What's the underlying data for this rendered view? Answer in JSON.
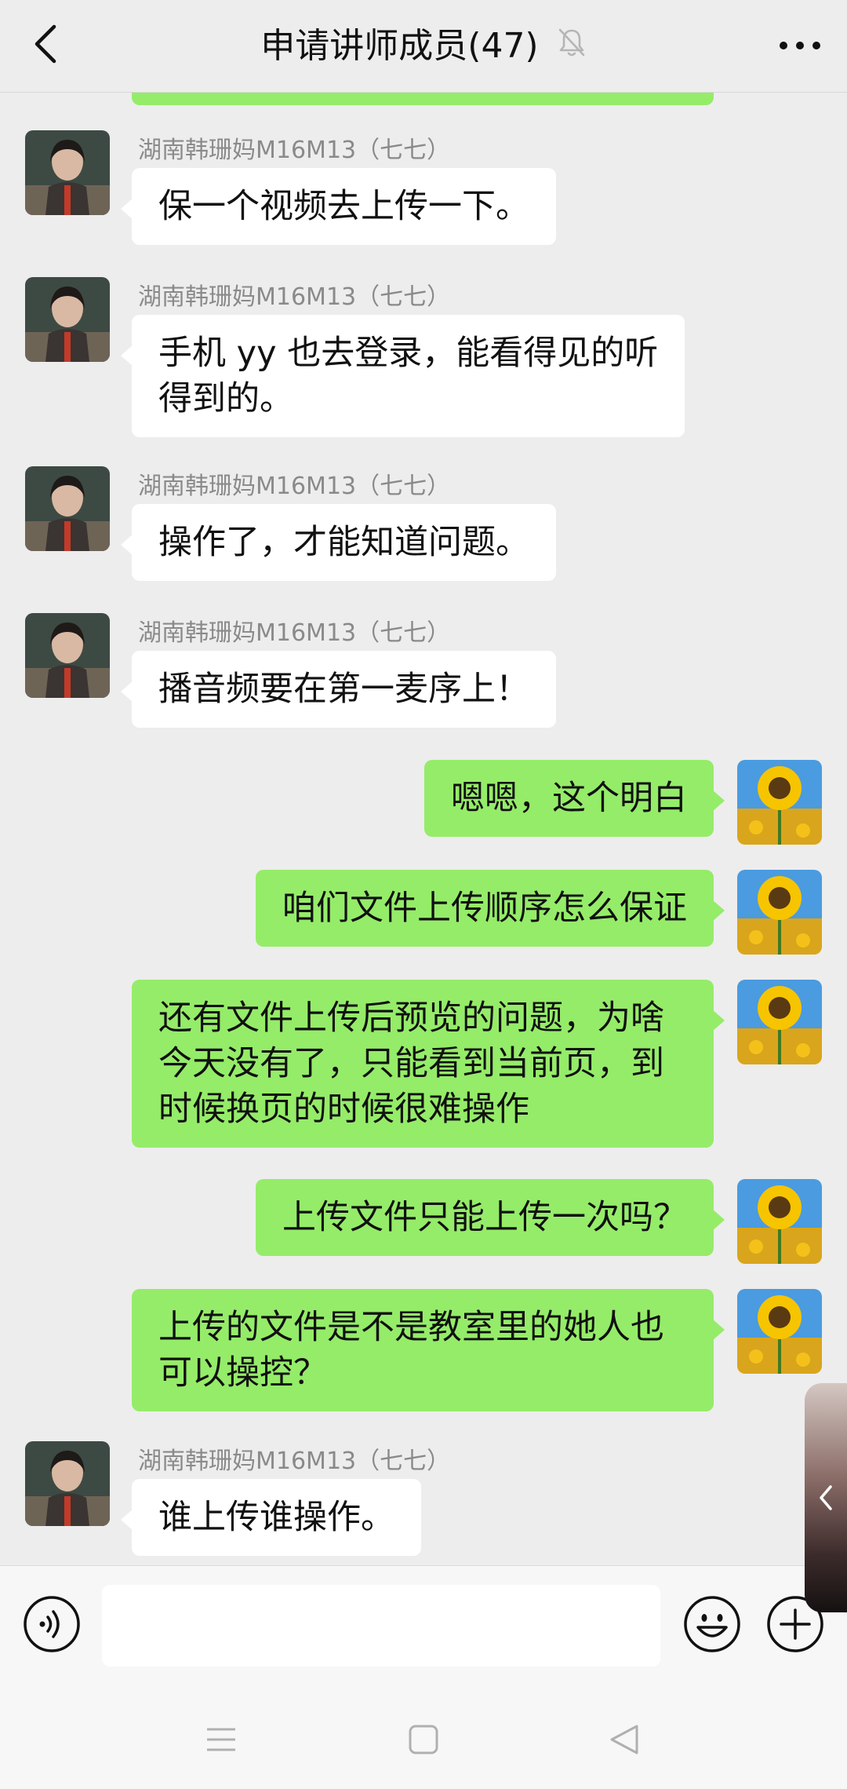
{
  "header": {
    "title": "申请讲师成员(47)",
    "back_icon": "chevron-left-icon",
    "mute_icon": "bell-off-icon",
    "more_icon": "more-horizontal-icon"
  },
  "messages": [
    {
      "dir": "in",
      "sender": "湖南韩珊妈M16M13（七七）",
      "lines": [
        "保一个视频去上传一下。"
      ]
    },
    {
      "dir": "in",
      "sender": "湖南韩珊妈M16M13（七七）",
      "lines": [
        "手机 yy 也去登录，能看得见的听",
        "得到的。"
      ]
    },
    {
      "dir": "in",
      "sender": "湖南韩珊妈M16M13（七七）",
      "lines": [
        "操作了，才能知道问题。"
      ]
    },
    {
      "dir": "in",
      "sender": "湖南韩珊妈M16M13（七七）",
      "lines": [
        "播音频要在第一麦序上！"
      ]
    },
    {
      "dir": "out",
      "lines": [
        "嗯嗯，这个明白"
      ]
    },
    {
      "dir": "out",
      "lines": [
        "咱们文件上传顺序怎么保证"
      ]
    },
    {
      "dir": "out",
      "lines": [
        "还有文件上传后预览的问题，为啥",
        "今天没有了，只能看到当前页，到",
        "时候换页的时候很难操作"
      ]
    },
    {
      "dir": "out",
      "lines": [
        "上传文件只能上传一次吗？"
      ]
    },
    {
      "dir": "out",
      "lines": [
        "上传的文件是不是教室里的她人也",
        "可以操控？"
      ]
    },
    {
      "dir": "in",
      "sender": "湖南韩珊妈M16M13（七七）",
      "lines": [
        "谁上传谁操作。"
      ]
    }
  ],
  "input_bar": {
    "placeholder": "",
    "voice_icon": "voice-icon",
    "emoji_icon": "emoji-icon",
    "plus_icon": "plus-circle-icon"
  },
  "colors": {
    "background": "#ededed",
    "outgoing_bubble": "#95ec69",
    "incoming_bubble": "#ffffff",
    "sender_text": "#8a8a8a"
  }
}
